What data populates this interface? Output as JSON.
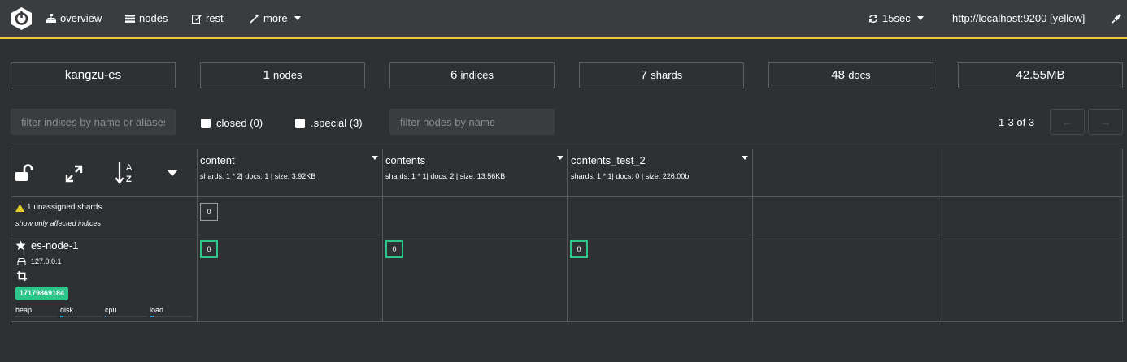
{
  "nav": {
    "items": [
      {
        "label": "overview",
        "icon": "sitemap-icon"
      },
      {
        "label": "nodes",
        "icon": "server-icon"
      },
      {
        "label": "rest",
        "icon": "edit-icon"
      },
      {
        "label": "more",
        "icon": "magic-wand-icon"
      }
    ],
    "refresh_label": "15sec",
    "cluster_url": "http://localhost:9200 [yellow]",
    "accent_color": "#e6cb2d"
  },
  "stats": {
    "cluster_name": "kangzu-es",
    "nodes": {
      "value": "1",
      "unit": "nodes"
    },
    "indices": {
      "value": "6",
      "unit": "indices"
    },
    "shards": {
      "value": "7",
      "unit": "shards"
    },
    "docs": {
      "value": "48",
      "unit": "docs"
    },
    "size": "42.55MB"
  },
  "filters": {
    "indices_placeholder": "filter indices by name or aliases",
    "closed_label": "closed (0)",
    "special_label": ".special (3)",
    "nodes_placeholder": "filter nodes by name",
    "pager_text": "1-3 of 3",
    "prev_label": "←",
    "next_label": "→"
  },
  "indices": [
    {
      "name": "content",
      "meta": "shards: 1 * 2| docs: 1 | size: 3.92KB"
    },
    {
      "name": "contents",
      "meta": "shards: 1 * 1| docs: 2 | size: 13.56KB"
    },
    {
      "name": "contents_test_2",
      "meta": "shards: 1 * 1| docs: 0 | size: 226.00b"
    }
  ],
  "unassigned": {
    "label": "1 unassigned shards",
    "link": "show only affected indices",
    "shard_label": "0"
  },
  "node": {
    "name": "es-node-1",
    "ip": "127.0.0.1",
    "badge": "17179869184",
    "badge_color": "#2ec58b",
    "shard_label": "0",
    "metrics": [
      {
        "label": "heap",
        "level": 0
      },
      {
        "label": "disk",
        "level": 0.08
      },
      {
        "label": "cpu",
        "level": 0.02
      },
      {
        "label": "load",
        "level": 0.1
      }
    ]
  }
}
